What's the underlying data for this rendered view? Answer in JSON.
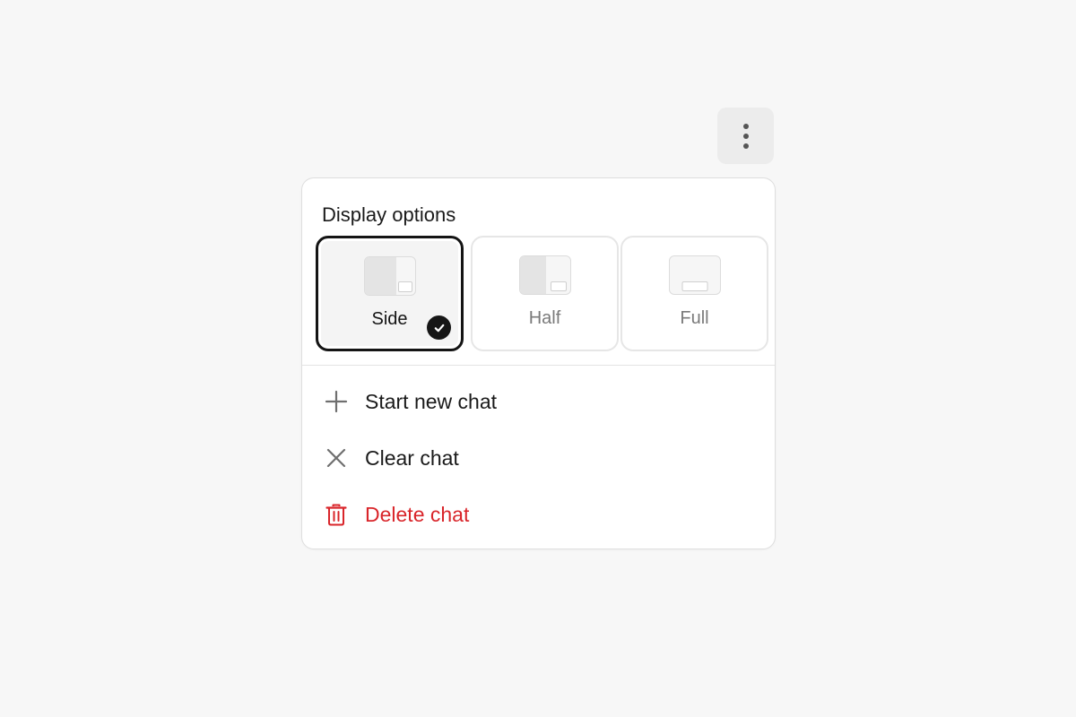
{
  "menu_button": {
    "icon": "more-vertical-icon"
  },
  "menu": {
    "title": "Display options",
    "display_options": [
      {
        "label": "Side",
        "selected": true,
        "icon": "layout-side-icon"
      },
      {
        "label": "Half",
        "selected": false,
        "icon": "layout-half-icon"
      },
      {
        "label": "Full",
        "selected": false,
        "icon": "layout-full-icon"
      }
    ],
    "actions": [
      {
        "label": "Start new chat",
        "icon": "plus-icon"
      },
      {
        "label": "Clear chat",
        "icon": "close-icon"
      },
      {
        "label": "Delete chat",
        "icon": "trash-icon",
        "danger": true
      }
    ]
  },
  "colors": {
    "background": "#f7f7f7",
    "surface": "#ffffff",
    "text": "#1a1a1a",
    "muted_text": "#7a7a7a",
    "selected_border": "#141414",
    "danger": "#d9252a"
  }
}
